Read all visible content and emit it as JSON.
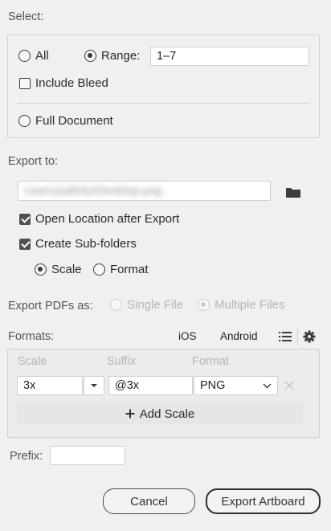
{
  "select": {
    "heading": "Select:",
    "all_label": "All",
    "range_label": "Range:",
    "range_value": "1–7",
    "include_bleed_label": "Include Bleed",
    "full_document_label": "Full Document"
  },
  "export_to": {
    "heading": "Export to:",
    "path_value": "Users/path/to/Desktop.png",
    "open_location_label": "Open Location after Export",
    "create_subfolders_label": "Create Sub-folders",
    "scale_label": "Scale",
    "format_label": "Format"
  },
  "export_pdfs": {
    "heading": "Export PDFs as:",
    "single_label": "Single File",
    "multiple_label": "Multiple Files"
  },
  "formats": {
    "heading": "Formats:",
    "ios_label": "iOS",
    "android_label": "Android",
    "col_scale": "Scale",
    "col_suffix": "Suffix",
    "col_format": "Format",
    "row": {
      "scale": "3x",
      "suffix": "@3x",
      "format": "PNG"
    },
    "add_scale_label": "Add Scale"
  },
  "prefix": {
    "label": "Prefix:",
    "value": ""
  },
  "buttons": {
    "cancel": "Cancel",
    "export": "Export Artboard"
  },
  "icons": [
    "folder-icon",
    "list-icon",
    "gear-icon",
    "chevron-down-icon",
    "close-icon",
    "plus-icon"
  ]
}
